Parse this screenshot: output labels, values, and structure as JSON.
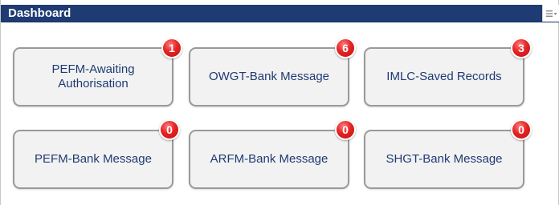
{
  "header": {
    "title": "Dashboard",
    "menu_icon": "menu-dropdown-icon",
    "background": "#1f3b73"
  },
  "tiles": [
    {
      "label": "PEFM-Awaiting Authorisation",
      "count": "1"
    },
    {
      "label": "OWGT-Bank Message",
      "count": "6"
    },
    {
      "label": "IMLC-Saved Records",
      "count": "3"
    },
    {
      "label": "PEFM-Bank Message",
      "count": "0"
    },
    {
      "label": "ARFM-Bank Message",
      "count": "0"
    },
    {
      "label": "SHGT-Bank Message",
      "count": "0"
    }
  ],
  "colors": {
    "tile_text": "#1f3b73",
    "badge": "#e32424",
    "tile_border": "#9a9a9a"
  }
}
